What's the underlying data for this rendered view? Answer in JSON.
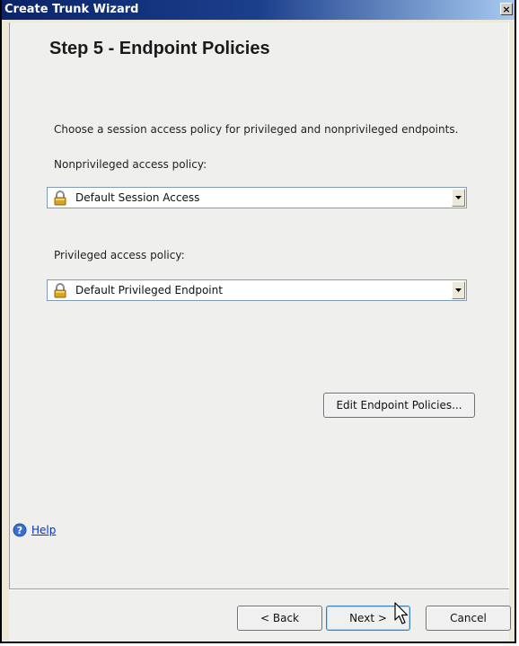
{
  "window": {
    "title": "Create Trunk Wizard",
    "close_glyph": "×"
  },
  "step": {
    "title": "Step 5 - Endpoint Policies",
    "instruction": "Choose a session access policy for privileged and nonprivileged endpoints."
  },
  "nonprivileged": {
    "label": "Nonprivileged access policy:",
    "value": "Default Session Access",
    "icon": "lock-icon"
  },
  "privileged": {
    "label": "Privileged access policy:",
    "value": "Default Privileged Endpoint",
    "icon": "lock-icon"
  },
  "buttons": {
    "edit_policies": "Edit Endpoint Policies...",
    "back": "< Back",
    "next": "Next >",
    "cancel": "Cancel"
  },
  "help": {
    "label": "Help",
    "icon": "help-icon"
  },
  "colors": {
    "titlebar": "#0a246a",
    "link": "#0033cc",
    "lock": "#d9a520"
  }
}
